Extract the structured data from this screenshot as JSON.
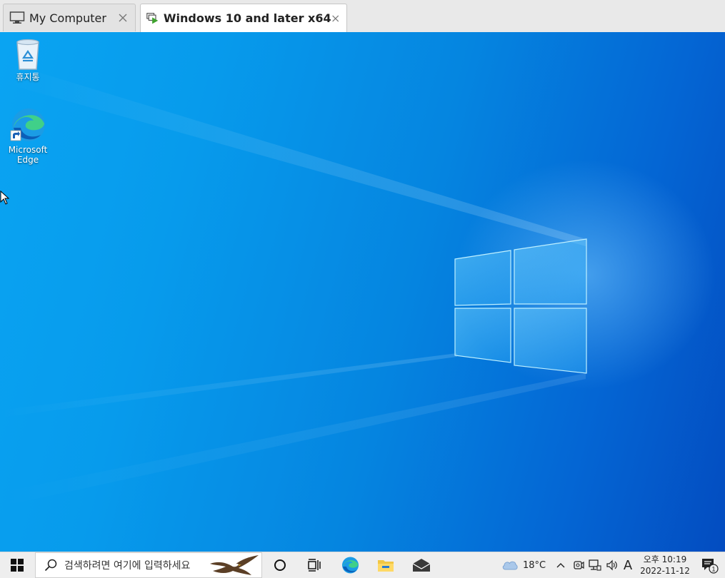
{
  "tabs": [
    {
      "label": "My Computer",
      "icon": "monitor-icon",
      "active": false
    },
    {
      "label": "Windows 10 and later x64",
      "icon": "vm-running-icon",
      "active": true
    }
  ],
  "desktop": {
    "icons": [
      {
        "label": "휴지통",
        "icon": "recycle-bin-icon"
      },
      {
        "label_line1": "Microsoft",
        "label_line2": "Edge",
        "icon": "edge-icon"
      }
    ]
  },
  "taskbar": {
    "search_placeholder": "검색하려면 여기에 입력하세요",
    "weather_temp": "18°C",
    "ime_label": "A",
    "clock_line1": "오후 10:19",
    "clock_line2": "2022-11-12",
    "notification_count": "1"
  },
  "colors": {
    "desktop_light": "#0aa4f2",
    "desktop_dark": "#034cc0",
    "taskbar_bg": "#eeeeee",
    "vm_running_green": "#3fa32f"
  }
}
